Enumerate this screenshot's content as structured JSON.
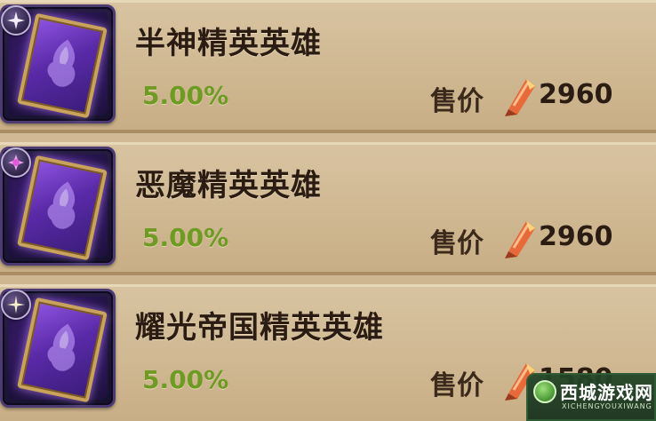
{
  "shop": {
    "price_label": "售价",
    "colors": {
      "rate_green": "#6f9a24",
      "text_dark": "#2a1c12",
      "card_purple": "#5a2aa8",
      "gold_border": "#c9a35a"
    },
    "items": [
      {
        "name": "半神精英英雄",
        "rate": "5.00%",
        "price": "2960",
        "faction_icon": "demigod-star-icon",
        "currency_icon": "crystal-icon"
      },
      {
        "name": "恶魔精英英雄",
        "rate": "5.00%",
        "price": "2960",
        "faction_icon": "demon-flower-icon",
        "currency_icon": "crystal-icon"
      },
      {
        "name": "耀光帝国精英英雄",
        "rate": "5.00%",
        "price": "1580",
        "faction_icon": "radiant-empire-sparkle-icon",
        "currency_icon": "crystal-icon"
      }
    ]
  },
  "watermark": {
    "title": "西城游戏网",
    "subtitle": "XICHENGYOUXIWANG"
  }
}
